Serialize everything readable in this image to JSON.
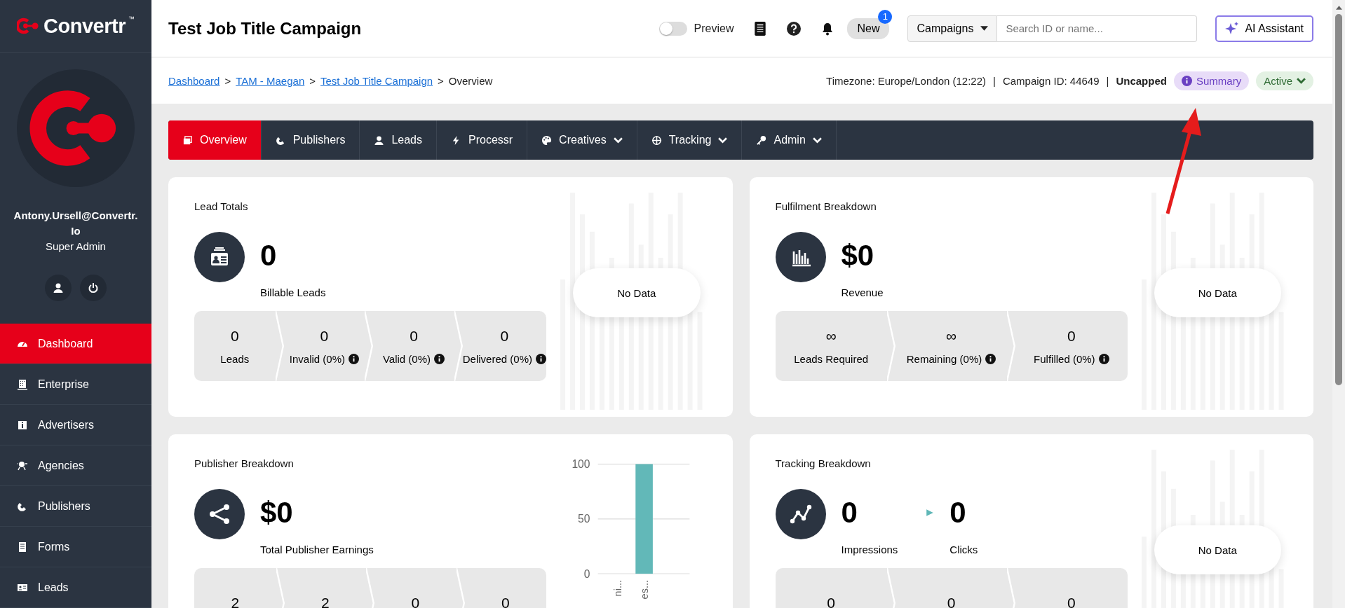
{
  "sidebar": {
    "logo": {
      "text": "Convertr",
      "mark": "™"
    },
    "user": {
      "name": "Antony.Ursell@Convertr.Io",
      "role": "Super Admin"
    },
    "items": [
      {
        "label": "Dashboard",
        "selected": true
      },
      {
        "label": "Enterprise",
        "selected": false
      },
      {
        "label": "Advertisers",
        "selected": false
      },
      {
        "label": "Agencies",
        "selected": false
      },
      {
        "label": "Publishers",
        "selected": false
      },
      {
        "label": "Forms",
        "selected": false
      },
      {
        "label": "Leads",
        "selected": false
      }
    ]
  },
  "header": {
    "title": "Test Job Title Campaign",
    "preview": {
      "label": "Preview",
      "on": false
    },
    "new_badge": {
      "label": "New",
      "count": "1"
    },
    "search": {
      "scope": "Campaigns",
      "placeholder": "Search ID or name..."
    },
    "ai_button": "AI Assistant"
  },
  "info_bar": {
    "breadcrumbs": [
      {
        "kind": "link",
        "label": "Dashboard"
      },
      {
        "kind": "separator",
        "label": ">"
      },
      {
        "kind": "link",
        "label": "TAM - Maegan"
      },
      {
        "kind": "separator",
        "label": ">"
      },
      {
        "kind": "link",
        "label": "Test Job Title Campaign"
      },
      {
        "kind": "separator",
        "label": ">"
      },
      {
        "kind": "current",
        "label": "Overview"
      }
    ],
    "meta": [
      {
        "kind": "text",
        "label": "Timezone: Europe/London (12:22)"
      },
      {
        "kind": "separator",
        "label": "|"
      },
      {
        "kind": "text",
        "label": "Campaign ID: 44649"
      },
      {
        "kind": "separator",
        "label": "|"
      },
      {
        "kind": "strong",
        "label": "Uncapped"
      }
    ],
    "summary": "Summary",
    "status": "Active"
  },
  "tabs": [
    {
      "label": "Overview",
      "dropdown": false,
      "selected": true
    },
    {
      "label": "Publishers",
      "dropdown": false,
      "selected": false
    },
    {
      "label": "Leads",
      "dropdown": false,
      "selected": false
    },
    {
      "label": "Processr",
      "dropdown": false,
      "selected": false
    },
    {
      "label": "Creatives",
      "dropdown": true,
      "selected": false
    },
    {
      "label": "Tracking",
      "dropdown": true,
      "selected": false
    },
    {
      "label": "Admin",
      "dropdown": true,
      "selected": false
    }
  ],
  "cards": [
    {
      "kind": "single",
      "title": "Lead Totals",
      "value": "0",
      "caption": "Billable Leads",
      "no_data": "No Data",
      "stats": [
        {
          "value": "0",
          "label": "Leads",
          "info": false
        },
        {
          "value": "0",
          "label": "Invalid (0%)",
          "info": true
        },
        {
          "value": "0",
          "label": "Valid (0%)",
          "info": true
        },
        {
          "value": "0",
          "label": "Delivered (0%)",
          "info": true
        }
      ]
    },
    {
      "kind": "single",
      "title": "Fulfilment Breakdown",
      "value": "$0",
      "caption": "Revenue",
      "no_data": "No Data",
      "stats": [
        {
          "value": "∞",
          "label": "Leads Required",
          "info": false
        },
        {
          "value": "∞",
          "label": "Remaining (0%)",
          "info": true
        },
        {
          "value": "0",
          "label": "Fulfilled (0%)",
          "info": true
        }
      ]
    },
    {
      "kind": "single",
      "title": "Publisher Breakdown",
      "value": "$0",
      "caption": "Total Publisher Earnings",
      "chart_data": {
        "type": "bar",
        "categories": [
          "ni...",
          "es..."
        ],
        "values": [
          0,
          100
        ],
        "ylim": [
          0,
          100
        ],
        "yticks": [
          0,
          50,
          100
        ]
      },
      "stats": [
        {
          "value": "2"
        },
        {
          "value": "2"
        },
        {
          "value": "0"
        },
        {
          "value": "0"
        }
      ]
    },
    {
      "kind": "pair",
      "title": "Tracking Breakdown",
      "value": "0",
      "caption": "Impressions",
      "value_2": "0",
      "caption_2": "Clicks",
      "no_data": "No Data",
      "stats": [
        {
          "value": "0"
        },
        {
          "value": "0"
        },
        {
          "value": "0"
        }
      ]
    }
  ]
}
